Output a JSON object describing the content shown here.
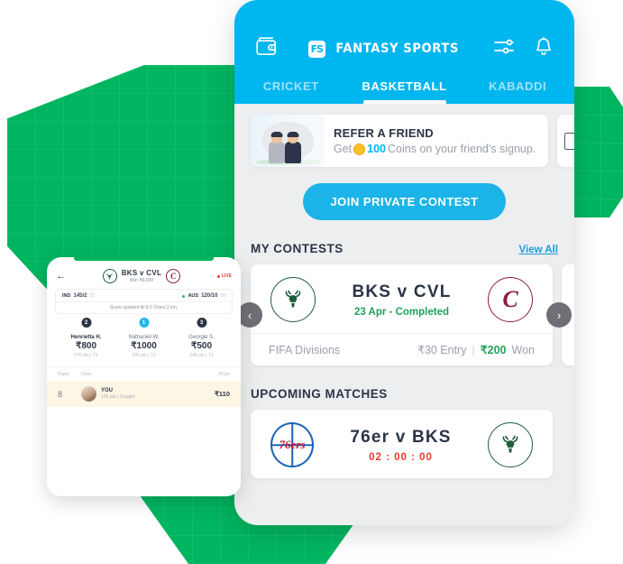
{
  "background": {
    "green": "#00b55f",
    "accent_cyan": "#00b6ef"
  },
  "main_phone": {
    "header": {
      "wallet_icon": "wallet-icon",
      "logo_mark": "FS",
      "logo_text": "FANTASY SPORTS",
      "filter_icon": "sliders-icon",
      "bell_icon": "bell-icon",
      "tabs": [
        {
          "label": "CRICKET",
          "active": false
        },
        {
          "label": "BASKETBALL",
          "active": true
        },
        {
          "label": "KABADDI",
          "active": false
        }
      ]
    },
    "banner": {
      "title": "REFER A FRIEND",
      "sub_prefix": "Get",
      "coins": "100",
      "sub_suffix": "Coins on your friend's signup."
    },
    "join_button": "JOIN PRIVATE CONTEST",
    "my_contests": {
      "title": "MY CONTESTS",
      "view_all": "View All",
      "prev_arrow": "‹",
      "next_arrow": "›",
      "card": {
        "home_team": "BKS",
        "away_team": "CVL",
        "match_title": "BKS  v  CVL",
        "status": "23 Apr - Completed",
        "league": "FIFA Divisions",
        "entry": "₹30 Entry",
        "divider": "|",
        "won_amount": "₹200",
        "won_label": "Won"
      }
    },
    "upcoming_matches": {
      "title": "UPCOMING MATCHES",
      "card": {
        "match_title": "76er  v  BKS",
        "timer": "02 : 00 : 00"
      }
    }
  },
  "contest_phone": {
    "back_icon": "back-arrow-icon",
    "match_title": "BKS v CVL",
    "win_label": "Win ₹6,000",
    "live_label": "LIVE",
    "score": {
      "team1": "IND",
      "team1_score": "145/2",
      "team1_overs": "20",
      "team2": "AUS",
      "team2_score": "120/10",
      "team2_overs": "08",
      "note": "Score updated till 8.5 Overs 2 inn."
    },
    "podium": [
      {
        "rank": "2",
        "name": "Henrietta H.",
        "prize": "₹800",
        "pts": "270 pts  |  T1"
      },
      {
        "rank": "1",
        "name": "Nathaniel W.",
        "prize": "₹1000",
        "pts": "300 pts  |  T2"
      },
      {
        "rank": "3",
        "name": "Georgie S.",
        "prize": "₹500",
        "pts": "248 pts  |  T1"
      }
    ],
    "table": {
      "headers": {
        "rank": "Rank",
        "user": "User",
        "prize": "Prize"
      },
      "row": {
        "rank": "8",
        "user": "YOU",
        "user_sub": "130 pts  |  Cricjam",
        "prize": "₹110"
      }
    }
  }
}
